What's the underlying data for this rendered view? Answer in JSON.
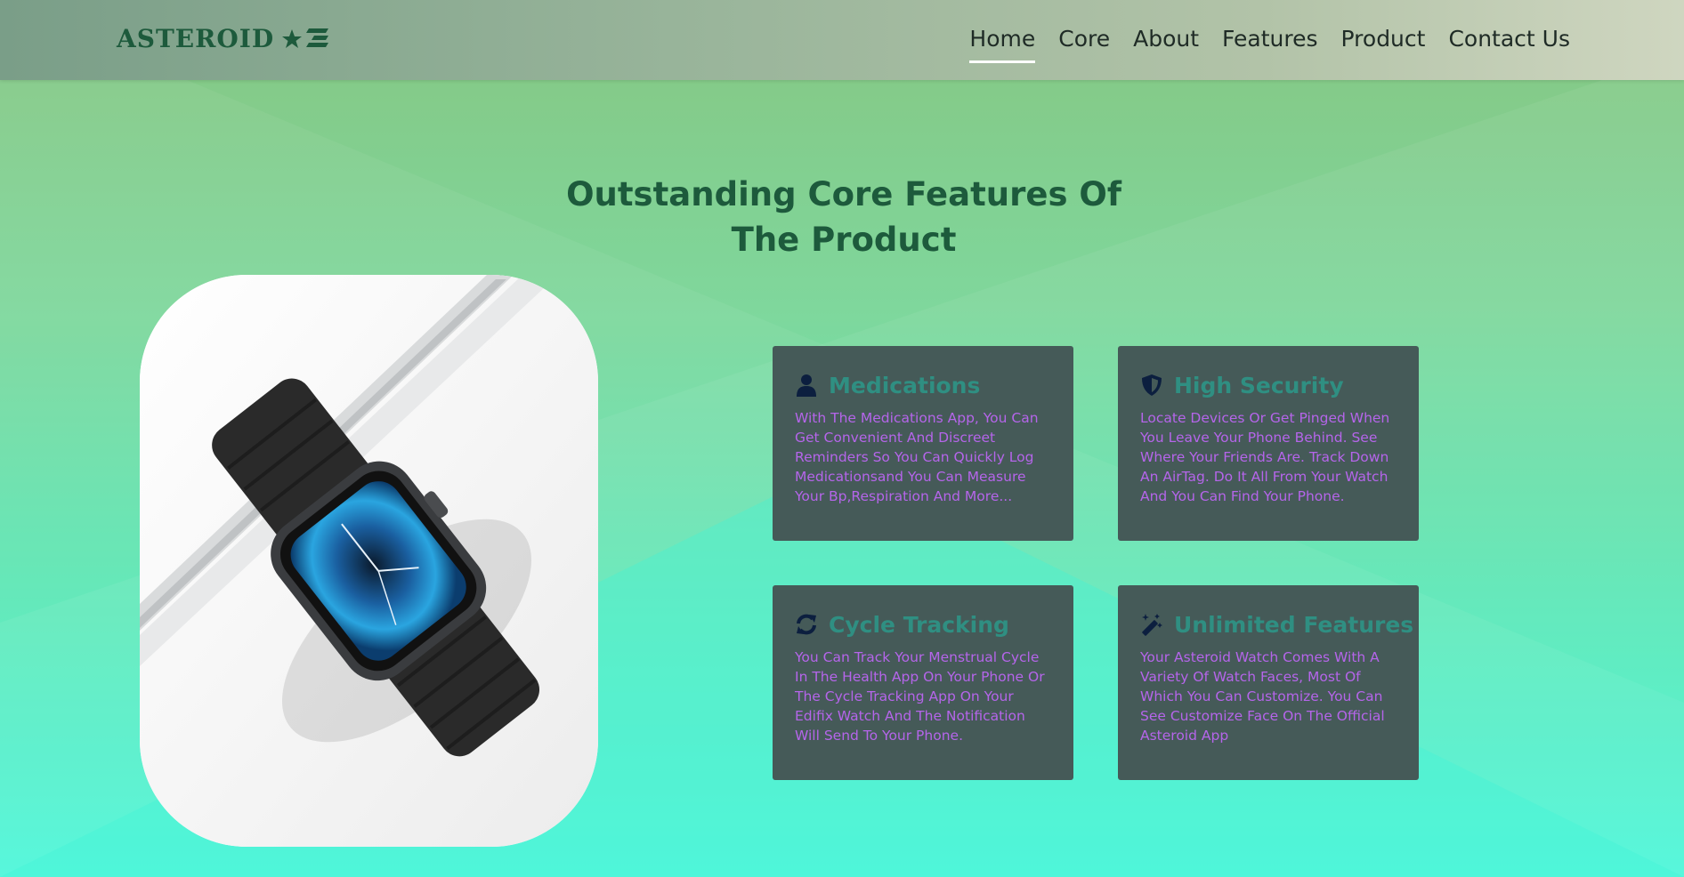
{
  "brand": {
    "name": "ASTEROID",
    "icons": [
      "star-icon",
      "stripes-icon"
    ]
  },
  "nav": {
    "items": [
      {
        "label": "Home",
        "active": true
      },
      {
        "label": "Core",
        "active": false
      },
      {
        "label": "About",
        "active": false
      },
      {
        "label": "Features",
        "active": false
      },
      {
        "label": "Product",
        "active": false
      },
      {
        "label": "Contact Us",
        "active": false
      }
    ]
  },
  "core": {
    "title_line1": "Outstanding Core Features Of",
    "title_line2": "The Product",
    "image": "smartwatch-photo",
    "features": [
      {
        "icon": "user-icon",
        "title": "Medications",
        "text": "With The Medications App, You Can Get Convenient And Discreet Reminders So You Can Quickly Log Medicationsand You Can Measure Your Bp,Respiration And More..."
      },
      {
        "icon": "shield-icon",
        "title": "High Security",
        "text": "Locate Devices Or Get Pinged When You Leave Your Phone Behind. See Where Your Friends Are. Track Down An AirTag. Do It All From Your Watch And You Can Find Your Phone."
      },
      {
        "icon": "sync-icon",
        "title": "Cycle Tracking",
        "text": "You Can Track Your Menstrual Cycle In The Health App On Your Phone Or The Cycle Tracking App On Your Edifix Watch And The Notification Will Send To Your Phone."
      },
      {
        "icon": "magic-wand-icon",
        "title": "Unlimited Features",
        "text": "Your Asteroid Watch Comes With A Variety Of Watch Faces, Most Of Which You Can Customize. You Can See Customize Face On The Official Asteroid App"
      }
    ]
  },
  "colors": {
    "heading": "#1d5a3c",
    "card_bg": "#455a58",
    "card_title": "#2f8f82",
    "card_text": "#b565ea",
    "icon": "#0c1f3f"
  }
}
